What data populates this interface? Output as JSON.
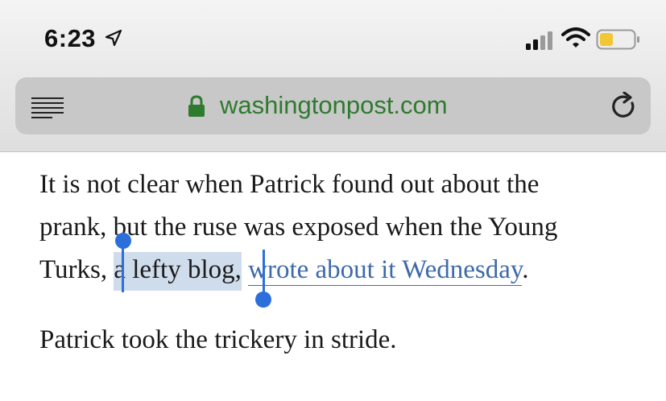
{
  "status_bar": {
    "time": "6:23",
    "icons": [
      "location-arrow-icon",
      "cellular-signal-icon",
      "wifi-icon",
      "battery-icon"
    ],
    "battery_color": "#f2c733"
  },
  "address_bar": {
    "domain": "washingtonpost.com",
    "icons": [
      "reader-view-icon",
      "lock-icon",
      "reload-icon"
    ],
    "domain_color": "#2e7a2e"
  },
  "article": {
    "p1_line1": "It is not clear when Patrick found out about the",
    "p1_line2": "prank, but the ruse was exposed when the Young",
    "p1_line3_before": "Turks, ",
    "p1_selected": "a lefty blog,",
    "p1_space": " ",
    "p1_link": "wrote about it Wednesday",
    "p1_end": ".",
    "p2_line1": "Patrick took the trickery in stride.",
    "selection_color": "#cfdcec",
    "link_color": "#3e6aa9",
    "handle_color": "#2c6fdb"
  }
}
